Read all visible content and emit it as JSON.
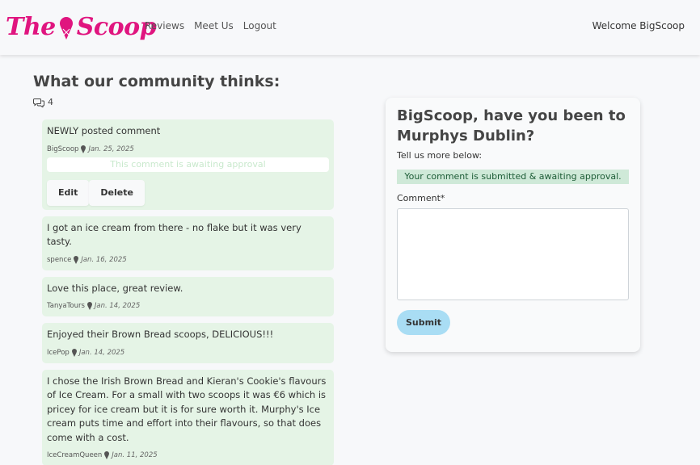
{
  "navbar": {
    "brand_left": "The",
    "brand_right": "Scoop",
    "links": [
      "Reviews",
      "Meet Us",
      "Logout"
    ],
    "welcome": "Welcome BigScoop"
  },
  "community": {
    "title": "What our community thinks:",
    "count": "4"
  },
  "comments": [
    {
      "body": "NEWLY posted comment",
      "author": "BigScoop",
      "date": "Jan. 25, 2025",
      "awaiting": "This comment is awaiting approval",
      "edit_label": "Edit",
      "delete_label": "Delete"
    },
    {
      "body": "I got an ice cream from there - no flake but it was very tasty.",
      "author": "spence",
      "date": "Jan. 16, 2025"
    },
    {
      "body": "Love this place, great review.",
      "author": "TanyaTours",
      "date": "Jan. 14, 2025"
    },
    {
      "body": "Enjoyed their Brown Bread scoops, DELICIOUS!!!",
      "author": "IcePop",
      "date": "Jan. 14, 2025"
    },
    {
      "body": "I chose the Irish Brown Bread and Kieran's Cookie's flavours of Ice Cream. For a small with two scoops it was €6 which is pricey for ice cream but it is for sure worth it. Murphy's Ice cream puts time and effort into their flavours, so that does come with a cost.",
      "author": "IceCreamQueen",
      "date": "Jan. 11, 2025"
    }
  ],
  "form": {
    "question": "BigScoop, have you been to Murphys Dublin?",
    "tell": "Tell us more below:",
    "alert": "Your comment is submitted & awaiting approval.",
    "comment_label": "Comment*",
    "comment_value": "",
    "submit_label": "Submit"
  },
  "colors": {
    "brand": "#e0157f",
    "comment_bg": "#e5f4e6",
    "alert_bg": "#cfe9d8",
    "submit_bg": "#a9ddf4"
  },
  "icons": {
    "comments": "comments-icon",
    "cone": "ice-cream-icon"
  }
}
